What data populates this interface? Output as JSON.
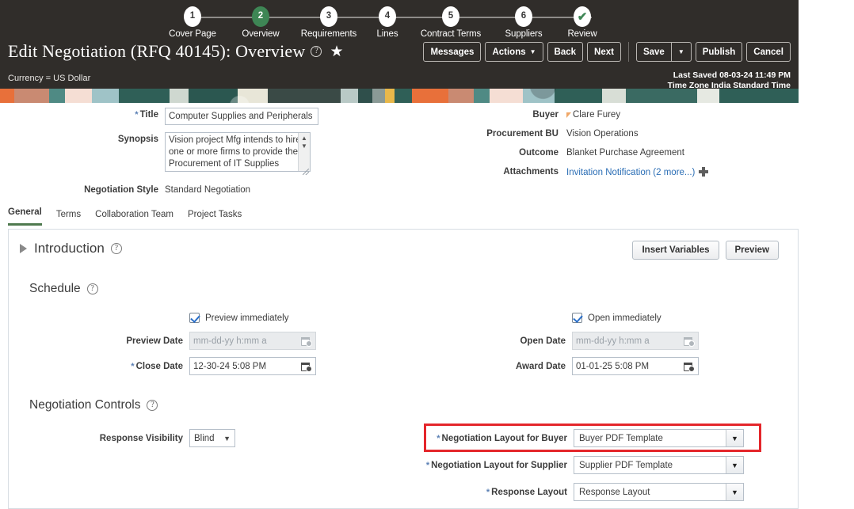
{
  "header": {
    "title": "Edit Negotiation (RFQ 40145): Overview",
    "help_icon": "question-circle-icon",
    "favorite_icon": "star-icon",
    "currency": "Currency = US Dollar",
    "last_saved": "Last Saved 08-03-24 11:49 PM",
    "time_zone": "Time Zone India Standard Time",
    "buttons": {
      "messages": "Messages",
      "actions": "Actions",
      "back": "Back",
      "next": "Next",
      "save": "Save",
      "publish": "Publish",
      "cancel": "Cancel"
    },
    "train": [
      {
        "num": "1",
        "label": "Cover Page",
        "state": "todo"
      },
      {
        "num": "2",
        "label": "Overview",
        "state": "current"
      },
      {
        "num": "3",
        "label": "Requirements",
        "state": "todo"
      },
      {
        "num": "4",
        "label": "Lines",
        "state": "todo"
      },
      {
        "num": "5",
        "label": "Contract Terms",
        "state": "todo"
      },
      {
        "num": "6",
        "label": "Suppliers",
        "state": "todo"
      },
      {
        "num": "✔",
        "label": "Review",
        "state": "done"
      }
    ]
  },
  "summary": {
    "title_label": "Title",
    "title_value": "Computer Supplies and Peripherals for",
    "synopsis_label": "Synopsis",
    "synopsis_value": "Vision project Mfg intends to hire one or more firms to provide the Procurement of IT Supplies",
    "negotiation_style_label": "Negotiation Style",
    "negotiation_style_value": "Standard Negotiation",
    "buyer_label": "Buyer",
    "buyer_value": "Clare Furey",
    "procurement_bu_label": "Procurement BU",
    "procurement_bu_value": "Vision Operations",
    "outcome_label": "Outcome",
    "outcome_value": "Blanket Purchase Agreement",
    "attachments_label": "Attachments",
    "attachments_value": "Invitation Notification (2 more...)"
  },
  "tabs": [
    {
      "label": "General",
      "active": true
    },
    {
      "label": "Terms",
      "active": false
    },
    {
      "label": "Collaboration Team",
      "active": false
    },
    {
      "label": "Project Tasks",
      "active": false
    }
  ],
  "panel": {
    "introduction": "Introduction",
    "insert_variables": "Insert Variables",
    "preview": "Preview",
    "schedule": {
      "heading": "Schedule",
      "preview_immediately": "Preview immediately",
      "preview_immediately_checked": true,
      "preview_date_label": "Preview Date",
      "preview_date_placeholder": "mm-dd-yy h:mm a",
      "preview_date_value": "",
      "close_date_label": "Close Date",
      "close_date_value": "12-30-24 5:08 PM",
      "open_immediately": "Open immediately",
      "open_immediately_checked": true,
      "open_date_label": "Open Date",
      "open_date_placeholder": "mm-dd-yy h:mm a",
      "open_date_value": "",
      "award_date_label": "Award Date",
      "award_date_value": "01-01-25 5:08 PM"
    },
    "controls": {
      "heading": "Negotiation Controls",
      "response_visibility_label": "Response Visibility",
      "response_visibility_value": "Blind",
      "layout_buyer_label": "Negotiation Layout for Buyer",
      "layout_buyer_value": "Buyer PDF Template",
      "layout_supplier_label": "Negotiation Layout for Supplier",
      "layout_supplier_value": "Supplier PDF Template",
      "response_layout_label": "Response Layout",
      "response_layout_value": "Response Layout"
    }
  },
  "colors": {
    "header_bg": "#302d2a",
    "accent_green": "#3e8655",
    "link_blue": "#2a6db5",
    "highlight_red": "#e4262b",
    "required_star": "#5a7fb4"
  }
}
